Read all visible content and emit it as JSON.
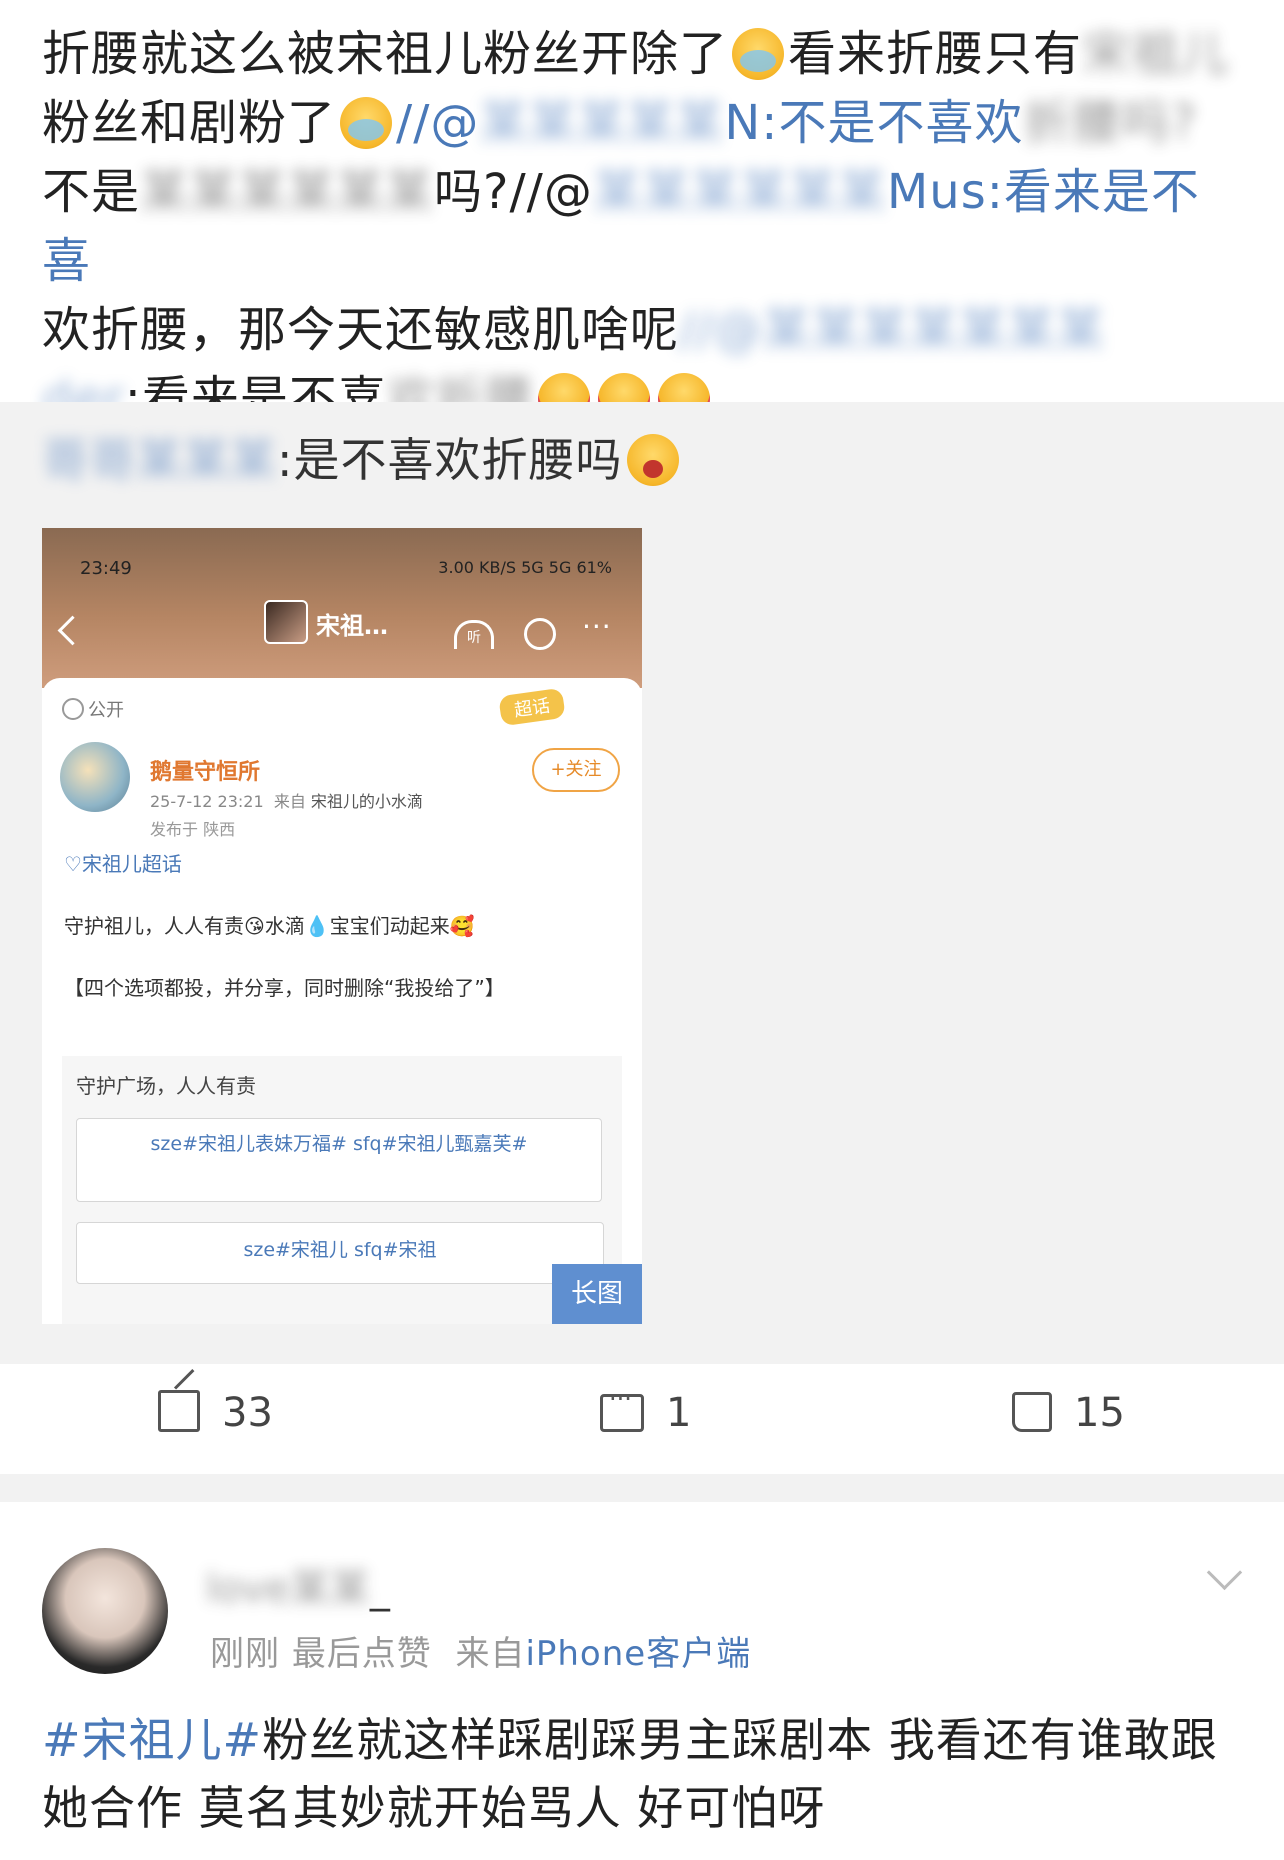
{
  "post": {
    "line1_a": "折腰就这么被宋祖儿粉丝开除了",
    "line1_b": "看来折腰只有",
    "line2_a": "粉丝和剧粉了",
    "line2_b": "//@",
    "line2_c": "N:不是不喜欢",
    "line2_blur": "折腰吗?",
    "line3_a": "不是",
    "line3_b": "吗?//@",
    "line3_c": "Mus:看来是不喜",
    "line4_a": "欢折腰，那今天还敏感肌啥呢",
    "line4_b": "//@",
    "line5_a": "der",
    "line5_b": ":看来是不喜",
    "line5_blur": "欢折腰"
  },
  "repost": {
    "user_blur": "哥哥",
    "text": ":是不喜欢折腰吗"
  },
  "embedded": {
    "time": "23:49",
    "status_right": "3.00 KB/S  5G  5G  61%",
    "title": "宋祖…",
    "listen_label": "听",
    "more": "···",
    "visibility": "公开",
    "supertopic_badge": "超话",
    "username": "鹅量守恒所",
    "date": "25-7-12 23:21",
    "from_prefix": "来自",
    "source": "宋祖儿的小水滴",
    "location": "发布于 陕西",
    "follow": "+关注",
    "topic": "宋祖儿超话",
    "body1": "守护祖儿，人人有责😘水滴💧宝宝们动起来🥰",
    "body2": "【四个选项都投，并分享，同时删除“我投给了”】",
    "vote_title": "守护广场，人人有责",
    "option1": "sze#宋祖儿表妹万福# sfq#宋祖儿甄嘉芙#",
    "option2": "sze#宋祖儿                 sfq#宋祖",
    "long_image": "长图"
  },
  "actions": {
    "share_count": "33",
    "comment_count": "1",
    "like_count": "15"
  },
  "comment": {
    "name": "love",
    "name_suffix": "_",
    "time": "刚刚",
    "last_like": "最后点赞",
    "from": "来自",
    "source": "iPhone客户端",
    "hashtag": "#宋祖儿#",
    "text": "粉丝就这样踩剧踩男主踩剧本 我看还有谁敢跟她合作 莫名其妙就开始骂人 好可怕呀"
  }
}
